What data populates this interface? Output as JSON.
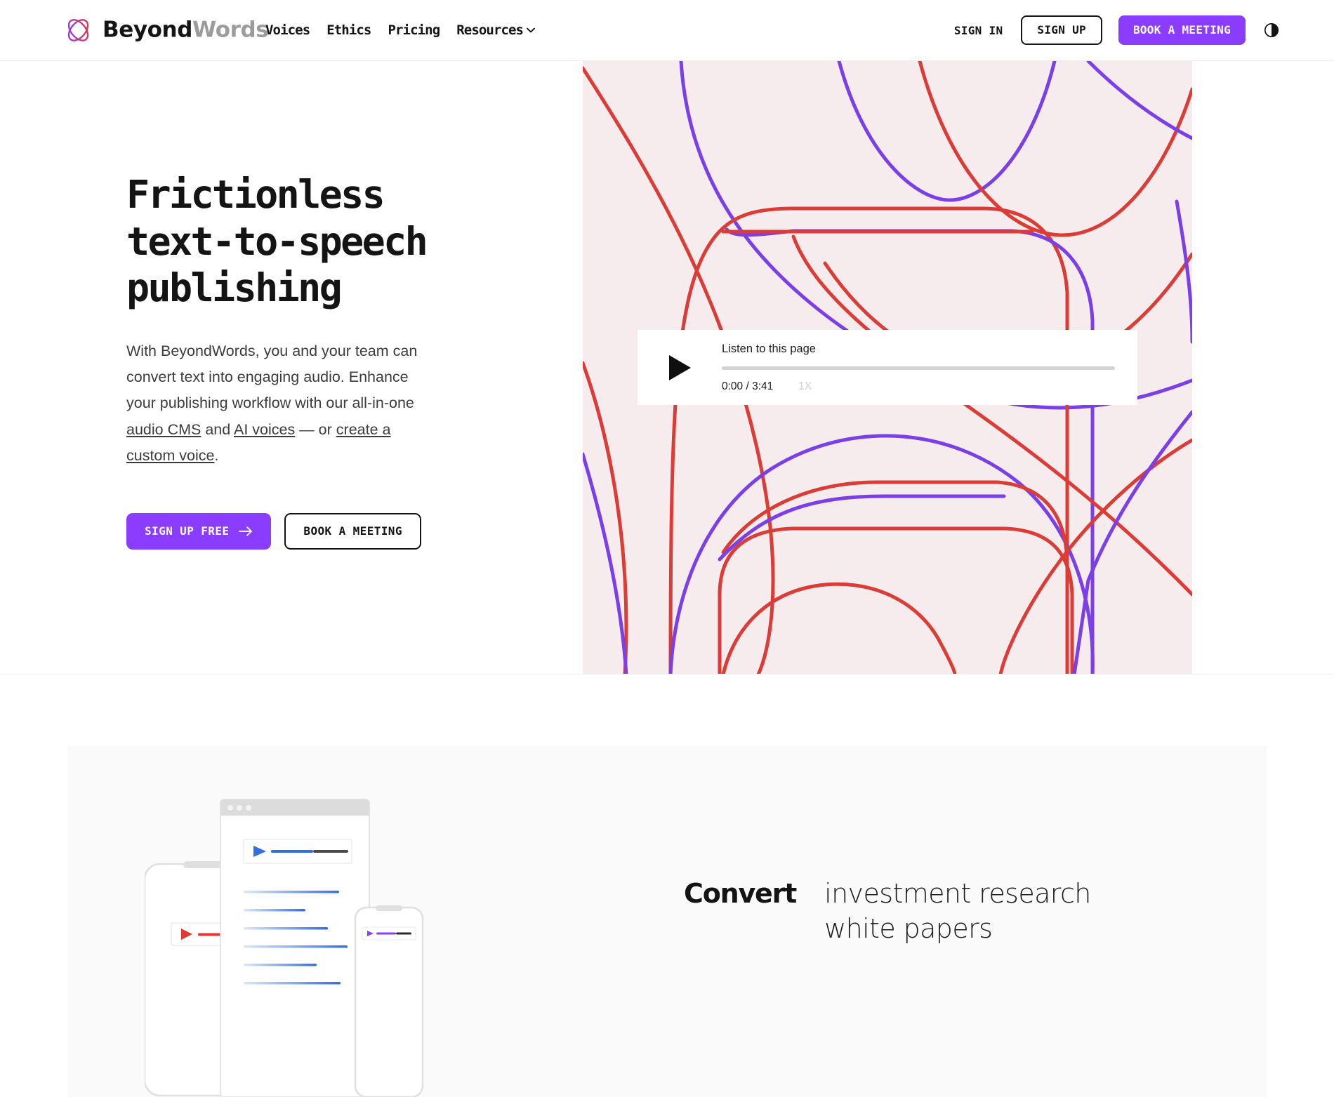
{
  "brand": {
    "name_part1": "Beyond",
    "name_part2": "Words",
    "logo_icon": "beyondwords-atom-logo",
    "accent_purple": "#8b3dff",
    "accent_red": "#dc3c36",
    "hero_bg": "#f6eced",
    "section_bg": "#fafafa"
  },
  "header": {
    "nav": [
      {
        "label": "Voices",
        "icon": null
      },
      {
        "label": "Ethics",
        "icon": null
      },
      {
        "label": "Pricing",
        "icon": null
      },
      {
        "label": "Resources",
        "icon": "chevron-down-icon"
      }
    ],
    "sign_in": "SIGN IN",
    "sign_up": "SIGN UP",
    "book_meeting": "BOOK A MEETING",
    "theme_toggle_icon": "contrast-circle-icon"
  },
  "hero": {
    "title": "Frictionless\ntext-to-speech\npublishing",
    "paragraph": {
      "seg1": "With BeyondWords, you and your team can convert text into engaging audio. Enhance your publishing workflow with our all-in-one ",
      "link1": "audio CMS",
      "seg2": " and ",
      "link2": "AI voices",
      "seg3": " — or ",
      "link3": "create a custom voice",
      "seg4": "."
    },
    "cta_primary": "SIGN UP FREE",
    "cta_primary_icon": "arrow-right-icon",
    "cta_secondary": "BOOK A MEETING",
    "player": {
      "title": "Listen to this page",
      "play_icon": "play-triangle-icon",
      "time": "0:00 / 3:41",
      "rate": "1X",
      "progress_percent": 0
    }
  },
  "section_convert": {
    "verb": "Convert",
    "phrase": "investment research\nwhite papers",
    "illustration": "multi-device-audio-player-mockup"
  }
}
